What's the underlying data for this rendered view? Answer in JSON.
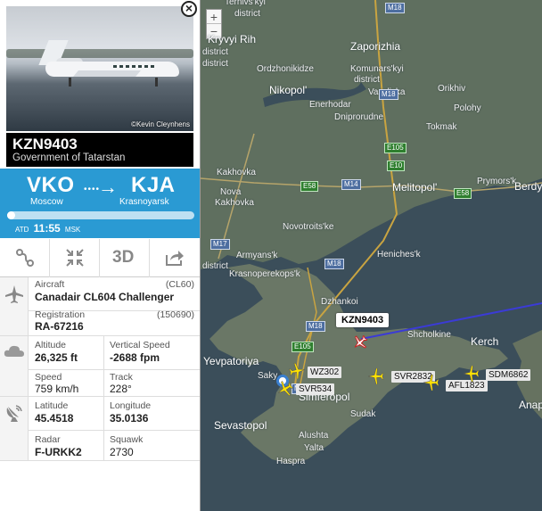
{
  "flight": {
    "callsign": "KZN9403",
    "operator": "Government of Tatarstan",
    "photo_credit": "©Kevin Cleynhens",
    "origin_code": "VKO",
    "origin_city": "Moscow",
    "dest_code": "KJA",
    "dest_city": "Krasnoyarsk",
    "route_dots": "••••",
    "route_arrow": "→",
    "atd_label": "ATD",
    "atd_time": "11:55",
    "atd_zone": "MSK",
    "progress_fraction": 0.02
  },
  "toolbar": {
    "route_icon": "route-icon",
    "focus_icon": "center-icon",
    "view3d_label": "3D",
    "share_icon": "share-icon"
  },
  "details": {
    "aircraft_label": "Aircraft",
    "aircraft_code": "(CL60)",
    "aircraft_value": "Canadair CL604 Challenger",
    "registration_label": "Registration",
    "registration_code": "(150690)",
    "registration_value": "RA-67216",
    "altitude_label": "Altitude",
    "altitude_value": "26,325 ft",
    "vspeed_label": "Vertical Speed",
    "vspeed_value": "-2688 fpm",
    "speed_label": "Speed",
    "speed_value": "759 km/h",
    "track_label": "Track",
    "track_value": "228°",
    "lat_label": "Latitude",
    "lat_value": "45.4518",
    "lon_label": "Longitude",
    "lon_value": "35.0136",
    "radar_label": "Radar",
    "radar_value": "F-URKK2",
    "squawk_label": "Squawk",
    "squawk_value": "2730"
  },
  "map": {
    "zoom_in": "+",
    "zoom_out": "−",
    "close_symbol": "×",
    "selected_label": "KZN9403",
    "places": {
      "ternivs": "Ternivs'kyi",
      "district_top": "district",
      "kryvyi": "Kryvyi Rih",
      "zaporizhia": "Zaporizhia",
      "district_k": "district",
      "ordzhonikidze": "Ordzhonikidze",
      "komunars": "Komunars'kyi",
      "district_k2": "district",
      "nikopol": "Nikopol'",
      "vasylivka": "Vasylivka",
      "orikhiv": "Orikhiv",
      "enerhodar": "Enerhodar",
      "dniprorudne": "Dniprorudne",
      "polohy": "Polohy",
      "tokmak": "Tokmak",
      "kakhovka": "Kakhovka",
      "nova": "Nova",
      "kakhovka2": "Kakhovka",
      "melitopol": "Melitopol'",
      "prymorsk": "Prymors'k",
      "berdy": "Berdy",
      "novotroits": "Novotroits'ke",
      "armyansk": "Armyans'k",
      "krasnoperekopsk": "Krasnoperekops'k",
      "henichesk": "Heniches'k",
      "dzhankoi": "Dzhankoi",
      "yevpatoriya": "Yevpatoriya",
      "saky": "Saky",
      "shcholkine": "Shcholkine",
      "kerch": "Kerch",
      "simferopol": "Simferopol",
      "sudak": "Sudak",
      "sevastopol": "Sevastopol",
      "alushta": "Alushta",
      "yalta": "Yalta",
      "haspra": "Haspra",
      "anapa": "Anap",
      "district_left1": "district",
      "district_left2": "district",
      "district_left3": "district"
    },
    "roads": {
      "m18_a": "M18",
      "m18_b": "M18",
      "m18_c": "M18",
      "m18_d": "M18",
      "m18_e": "M18",
      "e105_a": "E105",
      "e10": "E10",
      "e58_a": "E58",
      "m14": "M14",
      "e58_b": "E58",
      "m17": "M17",
      "e105_b": "E105"
    },
    "aircraft": {
      "wz302": "WZ302",
      "svr534": "SVR534",
      "svr2832": "SVR2832",
      "afl1823": "AFL1823",
      "sdm6862": "SDM6862"
    }
  }
}
